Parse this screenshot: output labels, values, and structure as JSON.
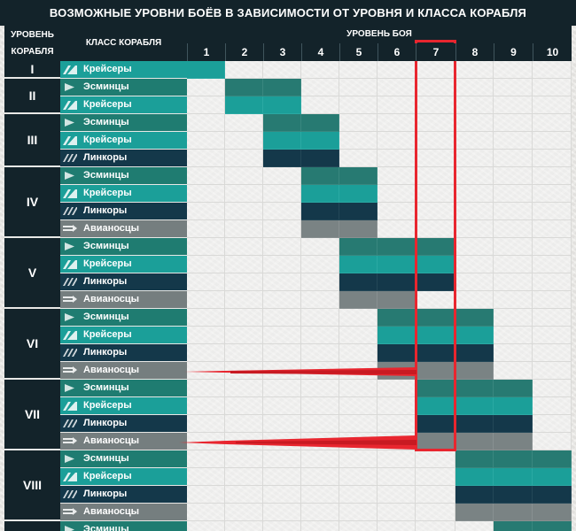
{
  "title": "Возможные уровни боёв в зависимости от уровня и класса корабля",
  "header": {
    "ship_level": "Уровень корабля",
    "ship_class": "Класс корабля",
    "battle_level": "Уровень боя"
  },
  "battle_levels": [
    "1",
    "2",
    "3",
    "4",
    "5",
    "6",
    "7",
    "8",
    "9",
    "10"
  ],
  "colors": {
    "cruiser": "#1b9f99",
    "destroyer": "#277a72",
    "battleship": "#14384a",
    "carrier": "#7a8384",
    "header": "#13232a",
    "highlight": "#e8262f"
  },
  "tiers": [
    {
      "tier": "I",
      "rows": [
        {
          "class": "cruiser",
          "label": "Крейсеры",
          "from": 1,
          "to": 1
        }
      ]
    },
    {
      "tier": "II",
      "rows": [
        {
          "class": "destroyer",
          "label": "Эсминцы",
          "from": 2,
          "to": 3
        },
        {
          "class": "cruiser",
          "label": "Крейсеры",
          "from": 2,
          "to": 3
        }
      ]
    },
    {
      "tier": "III",
      "rows": [
        {
          "class": "destroyer",
          "label": "Эсминцы",
          "from": 3,
          "to": 4
        },
        {
          "class": "cruiser",
          "label": "Крейсеры",
          "from": 3,
          "to": 4
        },
        {
          "class": "battleship",
          "label": "Линкоры",
          "from": 3,
          "to": 4
        }
      ]
    },
    {
      "tier": "IV",
      "rows": [
        {
          "class": "destroyer",
          "label": "Эсминцы",
          "from": 4,
          "to": 5
        },
        {
          "class": "cruiser",
          "label": "Крейсеры",
          "from": 4,
          "to": 5
        },
        {
          "class": "battleship",
          "label": "Линкоры",
          "from": 4,
          "to": 5
        },
        {
          "class": "carrier",
          "label": "Авианосцы",
          "from": 4,
          "to": 5
        }
      ]
    },
    {
      "tier": "V",
      "rows": [
        {
          "class": "destroyer",
          "label": "Эсминцы",
          "from": 5,
          "to": 7
        },
        {
          "class": "cruiser",
          "label": "Крейсеры",
          "from": 5,
          "to": 7
        },
        {
          "class": "battleship",
          "label": "Линкоры",
          "from": 5,
          "to": 7
        },
        {
          "class": "carrier",
          "label": "Авианосцы",
          "from": 5,
          "to": 6
        }
      ]
    },
    {
      "tier": "VI",
      "rows": [
        {
          "class": "destroyer",
          "label": "Эсминцы",
          "from": 6,
          "to": 8
        },
        {
          "class": "cruiser",
          "label": "Крейсеры",
          "from": 6,
          "to": 8
        },
        {
          "class": "battleship",
          "label": "Линкоры",
          "from": 6,
          "to": 8
        },
        {
          "class": "carrier",
          "label": "Авианосцы",
          "from": 6,
          "to": 8
        }
      ]
    },
    {
      "tier": "VII",
      "rows": [
        {
          "class": "destroyer",
          "label": "Эсминцы",
          "from": 7,
          "to": 9
        },
        {
          "class": "cruiser",
          "label": "Крейсеры",
          "from": 7,
          "to": 9
        },
        {
          "class": "battleship",
          "label": "Линкоры",
          "from": 7,
          "to": 9
        },
        {
          "class": "carrier",
          "label": "Авианосцы",
          "from": 7,
          "to": 9
        }
      ]
    },
    {
      "tier": "VIII",
      "rows": [
        {
          "class": "destroyer",
          "label": "Эсминцы",
          "from": 8,
          "to": 10
        },
        {
          "class": "cruiser",
          "label": "Крейсеры",
          "from": 8,
          "to": 10
        },
        {
          "class": "battleship",
          "label": "Линкоры",
          "from": 8,
          "to": 10
        },
        {
          "class": "carrier",
          "label": "Авианосцы",
          "from": 8,
          "to": 10
        }
      ]
    },
    {
      "tier": "",
      "rows": [
        {
          "class": "destroyer",
          "label": "Эсминцы",
          "from": 9,
          "to": 10
        }
      ]
    }
  ]
}
